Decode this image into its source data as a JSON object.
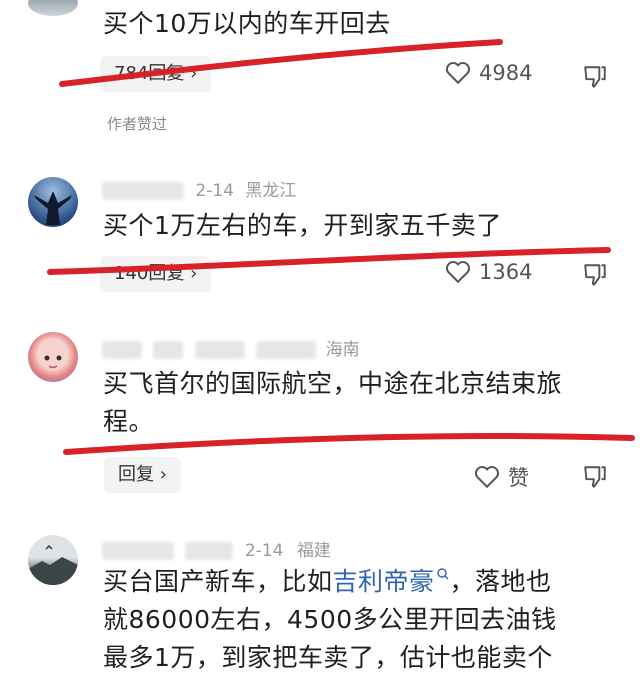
{
  "comments": [
    {
      "content": "买个10万以内的车开回去",
      "reply_label": "784回复",
      "likes": "4984",
      "author_liked": "作者赞过"
    },
    {
      "meta_date": "2-14",
      "meta_region": "黑龙江",
      "content": "买个1万左右的车，开到家五千卖了",
      "reply_label": "140回复",
      "likes": "1364"
    },
    {
      "meta_region": "海南",
      "content_line1": "买飞首尔的国际航空，中途在北京结束旅",
      "content_line2": "程。",
      "reply_label": "回复",
      "likes": "赞"
    },
    {
      "meta_date": "2-14",
      "meta_region": "福建",
      "content_line1_a": "买台国产新车，比如",
      "content_line1_link": "吉利帝豪",
      "content_line1_b": "，落地也",
      "content_line2": "就86000左右，4500多公里开回去油钱",
      "content_line3": "最多1万，到家把车卖了，估计也能卖个"
    }
  ],
  "icons": {
    "like": "heart-outline-icon",
    "dislike": "thumbs-down-icon",
    "chevron": "chevron-right-icon",
    "search": "search-icon"
  },
  "colors": {
    "annotation_red": "#d8222a",
    "link_blue": "#2f65b1"
  }
}
